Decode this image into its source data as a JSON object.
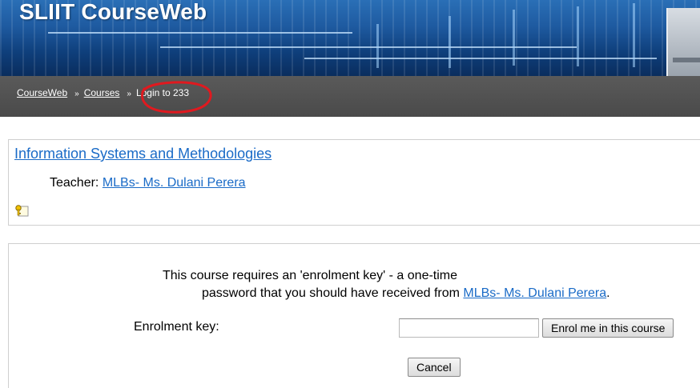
{
  "header": {
    "site_title": "SLIIT CourseWeb"
  },
  "breadcrumb": {
    "items": [
      {
        "label": "CourseWeb"
      },
      {
        "label": "Courses"
      }
    ],
    "separator": "»",
    "current": "Login to 233"
  },
  "annotation": {
    "color": "#e0191f"
  },
  "course": {
    "name": "Information Systems and Methodologies",
    "teacher_label": "Teacher:",
    "teacher_name": "MLBs- Ms. Dulani Perera",
    "key_icon": "key-icon"
  },
  "enrolment": {
    "message_line1": "This course requires an 'enrolment key' - a one-time",
    "message_line2_prefix": "password that you should have received from",
    "message_link": "MLBs- Ms. Dulani Perera",
    "message_suffix": ".",
    "key_label": "Enrolment key:",
    "key_value": "",
    "enrol_button": "Enrol me in this course",
    "cancel_button": "Cancel"
  },
  "colors": {
    "link": "#1a6bc7",
    "navbar": "#4f4f4f",
    "banner": "#1e5aa0"
  }
}
